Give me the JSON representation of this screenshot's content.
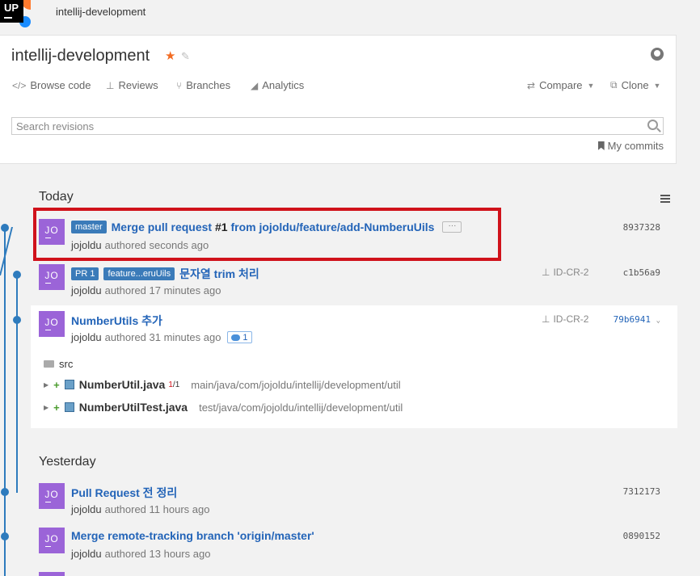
{
  "topbar": {
    "logo_text": "UP",
    "project": "intellij-development"
  },
  "header": {
    "title": "intellij-development",
    "nav": {
      "browse_code": "Browse code",
      "reviews": "Reviews",
      "branches": "Branches",
      "analytics": "Analytics",
      "compare": "Compare",
      "clone": "Clone"
    },
    "search_placeholder": "Search revisions",
    "my_commits": "My commits"
  },
  "sections": {
    "today": "Today",
    "yesterday": "Yesterday"
  },
  "commits": [
    {
      "initials": "JO",
      "tags": [
        "master"
      ],
      "message_pre": "Merge pull request ",
      "message_bold": "#1",
      "message_post": " from jojoldu/feature/add-NumberuUils",
      "author": "jojoldu",
      "time": "authored seconds ago",
      "hash": "8937328"
    },
    {
      "initials": "JO",
      "tags": [
        "PR 1",
        "feature...eruUils"
      ],
      "message": "문자열 trim 처리",
      "author": "jojoldu",
      "time": "authored 17 minutes ago",
      "review": "ID-CR-2",
      "hash": "c1b56a9"
    },
    {
      "initials": "JO",
      "message": "NumberUtils 추가",
      "author": "jojoldu",
      "time": "authored 31 minutes ago",
      "comments": "1",
      "review": "ID-CR-2",
      "hash": "79b6941"
    },
    {
      "initials": "JO",
      "message": "Pull Request 전 정리",
      "author": "jojoldu",
      "time": "authored 11 hours ago",
      "hash": "7312173"
    },
    {
      "initials": "JO",
      "message": "Merge remote-tracking branch 'origin/master'",
      "author": "jojoldu",
      "time": "authored 13 hours ago",
      "hash": "0890152"
    }
  ],
  "files": {
    "folder": "src",
    "items": [
      {
        "name": "NumberUtil.java",
        "rev_a": "1",
        "rev_b": "1",
        "path": "main/java/com/jojoldu/intellij/development/util"
      },
      {
        "name": "NumberUtilTest.java",
        "path": "test/java/com/jojoldu/intellij/development/util"
      }
    ]
  },
  "colors": {
    "accent": "#2364b8",
    "tag": "#3b7bb9",
    "avatar": "#9b64d8",
    "highlight": "#d0121b",
    "timeline": "#2e7bbd"
  }
}
